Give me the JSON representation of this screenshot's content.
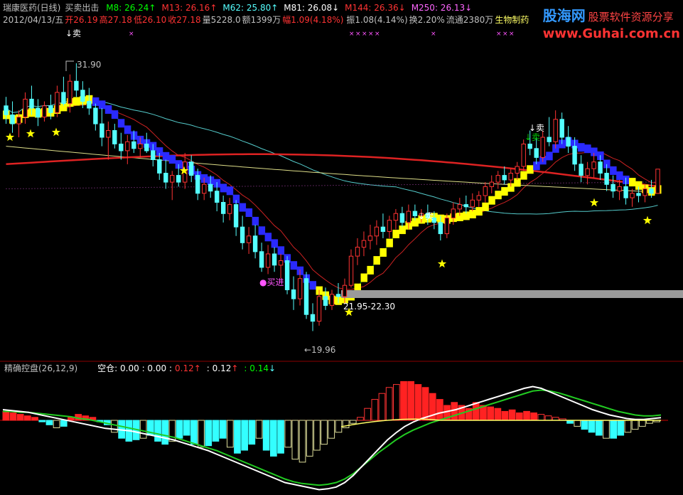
{
  "header": {
    "stock_title": "瑞康医药(日线)",
    "indicator_name": "买卖出击",
    "mas": [
      {
        "label": "M8: 26.24",
        "arrow": "↑",
        "color": "#00ff00"
      },
      {
        "label": "M13: 26.16",
        "arrow": "↑",
        "color": "#ff3333"
      },
      {
        "label": "M62: 25.80",
        "arrow": "↑",
        "color": "#55ffff"
      },
      {
        "label": "M81: 26.08",
        "arrow": "↓",
        "color": "#ffffff"
      },
      {
        "label": "M144: 26.36",
        "arrow": "↓",
        "color": "#ff3333"
      },
      {
        "label": "M250: 26.13",
        "arrow": "↓",
        "color": "#ff66ff"
      }
    ],
    "date": "2012/04/13/五",
    "open": "开26.19",
    "high": "高27.18",
    "low": "低26.10",
    "close": "收27.18",
    "volume": "量5228.0",
    "amount": "额1399万",
    "change": "幅1.09(4.18%)",
    "amplitude": "振1.08(4.14%)",
    "turnover": "换2.20%",
    "float_shares": "流通2380万",
    "sector": "生物制药"
  },
  "watermark": {
    "brand": "股海网",
    "slogan": "股票软件资源分享",
    "url": "www.Guhai.com.cn"
  },
  "annotations": {
    "sell_label": "↓卖",
    "buy_label": "●买进",
    "high_label": "31.90",
    "low_label": "←19.96",
    "range_label": "21.95-22.30",
    "cross_marks": "×"
  },
  "sub_panel": {
    "title": "精确控盘(26,12,9)",
    "values_label": "空仓: 0.00 : 0.00 :",
    "v1": "0.12",
    "v1_arrow": "↑",
    "v2": ": 0.12",
    "v2_arrow": "↑",
    "v3": ": 0.14",
    "v3_arrow": "↓"
  },
  "colors": {
    "up": "#ff3333",
    "down": "#55ffff",
    "ribbon_buy": "#ffff00",
    "ribbon_sell": "#2a2aff",
    "star": "#ffff00",
    "text_white": "#ffffff",
    "magenta": "#ff55ff"
  },
  "chart_data": {
    "type": "candlestick",
    "candles": [
      [
        30.0,
        30.4,
        29.2,
        29.6
      ],
      [
        29.6,
        30.2,
        28.8,
        29.2
      ],
      [
        29.2,
        29.8,
        28.6,
        29.5
      ],
      [
        29.5,
        30.6,
        29.2,
        30.3
      ],
      [
        30.3,
        30.9,
        29.6,
        29.9
      ],
      [
        29.9,
        30.3,
        29.1,
        29.5
      ],
      [
        29.5,
        30.2,
        29.3,
        30.0
      ],
      [
        30.0,
        30.5,
        29.4,
        29.7
      ],
      [
        29.7,
        30.9,
        29.5,
        30.6
      ],
      [
        30.6,
        31.3,
        30.0,
        30.1
      ],
      [
        30.1,
        31.4,
        29.7,
        31.1
      ],
      [
        31.1,
        31.9,
        30.4,
        30.7
      ],
      [
        30.7,
        31.1,
        29.9,
        30.2
      ],
      [
        30.2,
        30.8,
        29.6,
        29.9
      ],
      [
        29.9,
        30.1,
        28.9,
        29.2
      ],
      [
        29.2,
        29.9,
        28.2,
        28.6
      ],
      [
        28.6,
        29.3,
        27.6,
        28.9
      ],
      [
        28.9,
        29.2,
        28.1,
        28.3
      ],
      [
        28.3,
        28.8,
        27.6,
        28.0
      ],
      [
        28.0,
        28.7,
        27.4,
        28.4
      ],
      [
        28.4,
        28.9,
        27.9,
        28.1
      ],
      [
        28.1,
        28.6,
        27.7,
        28.3
      ],
      [
        28.3,
        28.8,
        27.9,
        28.0
      ],
      [
        28.0,
        28.3,
        27.3,
        27.6
      ],
      [
        27.6,
        27.9,
        26.7,
        27.0
      ],
      [
        27.0,
        27.6,
        26.3,
        26.6
      ],
      [
        26.6,
        27.1,
        25.8,
        26.9
      ],
      [
        26.9,
        27.4,
        26.4,
        26.6
      ],
      [
        26.6,
        27.9,
        26.3,
        27.5
      ],
      [
        27.5,
        27.8,
        26.6,
        26.9
      ],
      [
        26.9,
        27.2,
        25.8,
        26.1
      ],
      [
        26.1,
        26.8,
        25.8,
        26.5
      ],
      [
        26.5,
        26.9,
        25.9,
        26.2
      ],
      [
        26.2,
        26.6,
        25.3,
        25.7
      ],
      [
        25.7,
        26.0,
        24.8,
        25.2
      ],
      [
        25.2,
        25.9,
        24.9,
        25.6
      ],
      [
        25.6,
        25.8,
        24.2,
        24.6
      ],
      [
        24.6,
        25.1,
        23.6,
        23.9
      ],
      [
        23.9,
        24.6,
        23.4,
        24.2
      ],
      [
        24.2,
        24.7,
        23.2,
        23.5
      ],
      [
        23.5,
        23.9,
        22.6,
        22.8
      ],
      [
        22.8,
        23.8,
        22.5,
        23.4
      ],
      [
        23.4,
        23.7,
        22.6,
        22.9
      ],
      [
        22.9,
        23.4,
        22.3,
        23.1
      ],
      [
        23.1,
        23.3,
        21.6,
        21.8
      ],
      [
        21.8,
        22.4,
        20.9,
        21.4
      ],
      [
        21.4,
        22.7,
        21.1,
        22.3
      ],
      [
        22.3,
        22.6,
        20.5,
        20.7
      ],
      [
        20.7,
        21.2,
        19.96,
        20.4
      ],
      [
        20.4,
        21.8,
        20.2,
        21.5
      ],
      [
        21.5,
        21.9,
        20.9,
        21.1
      ],
      [
        21.1,
        21.8,
        20.9,
        21.6
      ],
      [
        21.6,
        22.1,
        21.2,
        21.5
      ],
      [
        21.5,
        22.3,
        21.2,
        22.0
      ],
      [
        22.0,
        23.6,
        21.9,
        23.3
      ],
      [
        23.3,
        24.1,
        22.9,
        23.7
      ],
      [
        23.7,
        24.4,
        23.3,
        24.0
      ],
      [
        24.0,
        24.7,
        23.6,
        24.2
      ],
      [
        24.2,
        24.9,
        23.8,
        24.6
      ],
      [
        24.6,
        25.2,
        24.1,
        24.4
      ],
      [
        24.4,
        25.1,
        24.1,
        24.9
      ],
      [
        24.9,
        25.4,
        24.5,
        25.2
      ],
      [
        25.2,
        25.5,
        24.6,
        24.8
      ],
      [
        24.8,
        25.6,
        24.5,
        25.3
      ],
      [
        25.3,
        25.6,
        24.9,
        25.1
      ],
      [
        25.1,
        25.4,
        24.8,
        25.2
      ],
      [
        25.2,
        25.6,
        24.7,
        25.0
      ],
      [
        25.0,
        25.3,
        24.5,
        24.8
      ],
      [
        24.8,
        25.1,
        24.0,
        24.3
      ],
      [
        24.3,
        25.2,
        24.1,
        25.0
      ],
      [
        25.0,
        25.7,
        24.7,
        25.4
      ],
      [
        25.4,
        25.9,
        25.1,
        25.6
      ],
      [
        25.6,
        26.0,
        25.2,
        25.5
      ],
      [
        25.5,
        26.1,
        25.3,
        25.8
      ],
      [
        25.8,
        26.2,
        25.5,
        26.0
      ],
      [
        26.0,
        26.6,
        25.7,
        26.4
      ],
      [
        26.4,
        26.9,
        26.1,
        26.6
      ],
      [
        26.6,
        27.1,
        26.3,
        26.9
      ],
      [
        26.9,
        27.3,
        26.5,
        26.7
      ],
      [
        26.7,
        27.2,
        26.4,
        27.0
      ],
      [
        27.0,
        27.5,
        26.7,
        27.3
      ],
      [
        27.3,
        28.5,
        27.1,
        28.3
      ],
      [
        28.3,
        28.9,
        27.8,
        28.1
      ],
      [
        28.1,
        28.6,
        27.4,
        27.7
      ],
      [
        27.7,
        28.9,
        27.5,
        28.6
      ],
      [
        28.6,
        29.5,
        28.2,
        28.4
      ],
      [
        28.4,
        29.8,
        28.1,
        29.4
      ],
      [
        29.4,
        29.7,
        28.3,
        28.6
      ],
      [
        28.6,
        29.1,
        27.9,
        28.2
      ],
      [
        28.2,
        28.6,
        27.1,
        27.4
      ],
      [
        27.4,
        27.8,
        26.6,
        26.9
      ],
      [
        26.9,
        27.5,
        26.5,
        27.2
      ],
      [
        27.2,
        27.9,
        26.8,
        27.5
      ],
      [
        27.5,
        27.8,
        26.7,
        27.0
      ],
      [
        27.0,
        27.4,
        26.2,
        26.5
      ],
      [
        26.5,
        26.9,
        25.9,
        26.2
      ],
      [
        26.2,
        26.7,
        25.8,
        26.4
      ],
      [
        26.4,
        26.8,
        25.6,
        25.9
      ],
      [
        25.9,
        26.3,
        25.5,
        26.1
      ],
      [
        26.1,
        26.4,
        25.7,
        26.0
      ],
      [
        26.0,
        26.5,
        25.7,
        26.3
      ],
      [
        26.3,
        26.7,
        25.9,
        26.1
      ],
      [
        26.1,
        27.18,
        26.1,
        27.18
      ]
    ],
    "indicator": {
      "title": "精确控盘(26,12,9)",
      "bars": [
        0.06,
        0.05,
        0.04,
        0.03,
        0.02,
        -0.01,
        -0.03,
        -0.05,
        -0.04,
        0.02,
        0.04,
        0.03,
        0.02,
        -0.01,
        -0.03,
        -0.08,
        -0.12,
        -0.14,
        -0.13,
        -0.12,
        -0.1,
        -0.14,
        -0.16,
        -0.14,
        -0.12,
        -0.1,
        -0.16,
        -0.18,
        -0.17,
        -0.14,
        -0.12,
        -0.18,
        -0.22,
        -0.2,
        -0.16,
        -0.12,
        -0.2,
        -0.24,
        -0.22,
        -0.18,
        -0.26,
        -0.28,
        -0.24,
        -0.2,
        -0.16,
        -0.12,
        -0.08,
        -0.05,
        -0.02,
        0.02,
        0.08,
        0.14,
        0.18,
        0.22,
        0.24,
        0.26,
        0.26,
        0.24,
        0.22,
        0.18,
        0.14,
        0.1,
        0.12,
        0.1,
        0.08,
        0.12,
        0.1,
        0.09,
        0.08,
        0.06,
        0.07,
        0.05,
        0.06,
        0.05,
        0.04,
        0.03,
        0.02,
        0.01,
        -0.02,
        -0.04,
        -0.06,
        -0.08,
        -0.1,
        -0.12,
        -0.12,
        -0.1,
        -0.08,
        -0.06,
        -0.04,
        -0.02,
        -0.01
      ],
      "dif": [
        0.12,
        0.11,
        0.1,
        0.09,
        0.07,
        0.05,
        0.03,
        0.01,
        -0.01,
        -0.03,
        -0.05,
        -0.07,
        -0.09,
        -0.1,
        -0.11,
        -0.12,
        -0.14,
        -0.16,
        -0.18,
        -0.2,
        -0.22,
        -0.25,
        -0.28,
        -0.31,
        -0.34,
        -0.38,
        -0.42,
        -0.46,
        -0.5,
        -0.54,
        -0.58,
        -0.62,
        -0.66,
        -0.7,
        -0.72,
        -0.74,
        -0.76,
        -0.78,
        -0.77,
        -0.75,
        -0.7,
        -0.62,
        -0.52,
        -0.42,
        -0.32,
        -0.22,
        -0.14,
        -0.07,
        -0.02,
        0.02,
        0.05,
        0.08,
        0.1,
        0.12,
        0.15,
        0.18,
        0.21,
        0.24,
        0.27,
        0.3,
        0.33,
        0.36,
        0.38,
        0.36,
        0.32,
        0.28,
        0.24,
        0.2,
        0.16,
        0.12,
        0.09,
        0.06,
        0.04,
        0.02,
        0.01,
        0.01,
        0.02,
        0.03
      ],
      "dea": [
        0.1,
        0.1,
        0.09,
        0.09,
        0.08,
        0.07,
        0.06,
        0.05,
        0.04,
        0.02,
        0.01,
        -0.01,
        -0.03,
        -0.05,
        -0.07,
        -0.09,
        -0.11,
        -0.13,
        -0.15,
        -0.17,
        -0.19,
        -0.22,
        -0.25,
        -0.28,
        -0.31,
        -0.34,
        -0.38,
        -0.42,
        -0.46,
        -0.5,
        -0.54,
        -0.58,
        -0.62,
        -0.66,
        -0.69,
        -0.71,
        -0.72,
        -0.73,
        -0.72,
        -0.7,
        -0.66,
        -0.6,
        -0.52,
        -0.44,
        -0.36,
        -0.29,
        -0.22,
        -0.16,
        -0.11,
        -0.07,
        -0.03,
        0.0,
        0.03,
        0.06,
        0.09,
        0.12,
        0.15,
        0.18,
        0.21,
        0.24,
        0.27,
        0.3,
        0.33,
        0.34,
        0.33,
        0.31,
        0.28,
        0.25,
        0.22,
        0.19,
        0.16,
        0.13,
        0.1,
        0.08,
        0.06,
        0.05,
        0.05,
        0.06
      ]
    }
  }
}
